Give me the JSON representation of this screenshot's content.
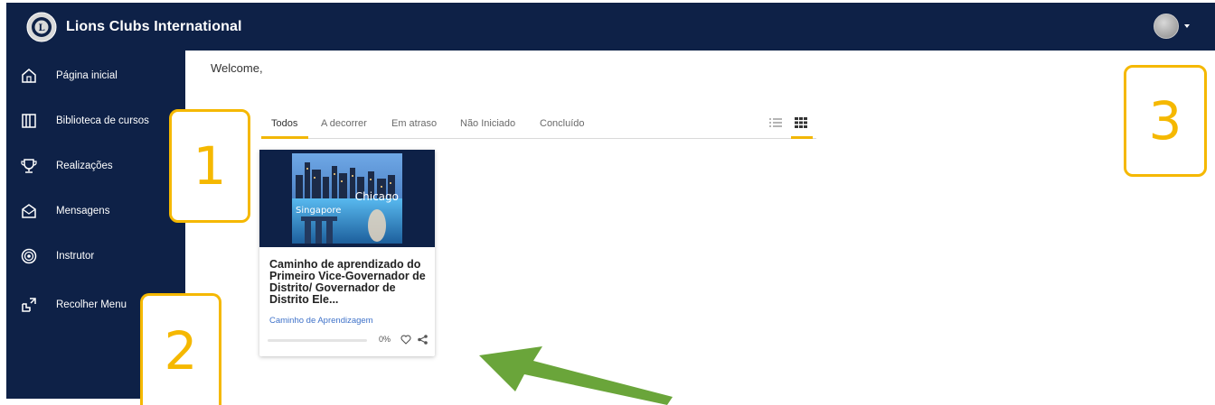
{
  "header": {
    "app_title": "Lions Clubs International",
    "logo_icon": "lions-club-emblem-icon",
    "user_icon": "user-avatar-icon"
  },
  "sidebar": {
    "items": [
      {
        "label": "Página inicial",
        "icon": "home-icon"
      },
      {
        "label": "Biblioteca de cursos",
        "icon": "library-icon"
      },
      {
        "label": "Realizações",
        "icon": "trophy-icon"
      },
      {
        "label": "Mensagens",
        "icon": "envelope-icon"
      },
      {
        "label": "Instrutor",
        "icon": "instructor-icon"
      },
      {
        "label": "Recolher Menu",
        "icon": "collapse-menu-icon"
      }
    ]
  },
  "main": {
    "welcome": "Welcome,",
    "tabs": [
      "Todos",
      "A decorrer",
      "Em atraso",
      "Não Iniciado",
      "Concluído"
    ],
    "active_tab": "Todos",
    "active_view": "grid"
  },
  "card": {
    "image_caption_1": "Chicago",
    "image_caption_2": "Singapore",
    "title": "Caminho de aprendizado do Primeiro Vice-Governador de Distrito/ Governador de Distrito Ele...",
    "type": "Caminho de Aprendizagem",
    "progress_text": "0%",
    "progress_value": 0
  },
  "callouts": [
    "1",
    "2",
    "3"
  ],
  "colors": {
    "navy": "#0e2147",
    "accent": "#f2b705",
    "callout": "#f5b800",
    "link": "#3f72c9",
    "arrow": "#6aa53a"
  }
}
